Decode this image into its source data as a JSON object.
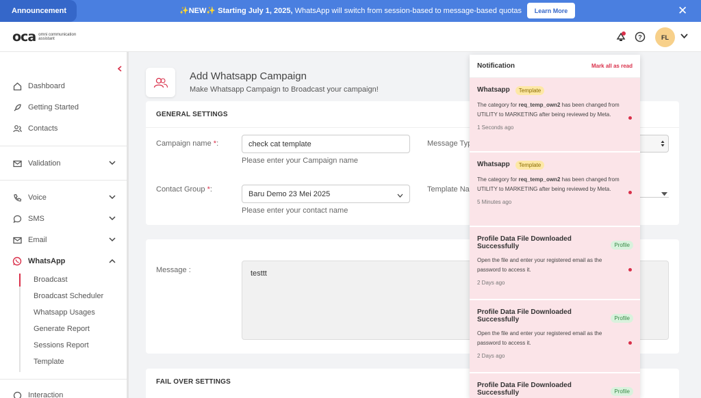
{
  "announcement": {
    "tag": "Announcement",
    "new_label": "✨NEW✨",
    "headline": "Starting July 1, 2025,",
    "message": "WhatsApp will switch from session-based to message-based quotas",
    "learn_more": "Learn More",
    "close": "✕"
  },
  "header": {
    "logo_mark": "oca",
    "logo_sub": "omni communication assistant",
    "avatar": "FL"
  },
  "sidebar": {
    "items": [
      {
        "label": "Dashboard"
      },
      {
        "label": "Getting Started"
      },
      {
        "label": "Contacts"
      },
      {
        "label": "Validation"
      },
      {
        "label": "Voice"
      },
      {
        "label": "SMS"
      },
      {
        "label": "Email"
      },
      {
        "label": "WhatsApp"
      },
      {
        "label": "Interaction"
      }
    ],
    "whatsapp_sub": [
      "Broadcast",
      "Broadcast Scheduler",
      "Whatsapp Usages",
      "Generate Report",
      "Sessions Report",
      "Template"
    ]
  },
  "page": {
    "title": "Add Whatsapp Campaign",
    "subtitle": "Make Whatsapp Campaign to Broadcast your campaign!"
  },
  "general": {
    "title": "GENERAL SETTINGS",
    "campaign_label": "Campaign name",
    "campaign_value": "check cat template",
    "campaign_help": "Please enter your Campaign name",
    "message_type_label": "Message Typ",
    "contact_label": "Contact Group",
    "contact_value": "Baru Demo 23 Mei 2025",
    "contact_help": "Please enter your contact name",
    "template_label": "Template Na",
    "required": "*",
    "colon": ":"
  },
  "message": {
    "label": "Message :",
    "value": "testtt"
  },
  "failover": {
    "title": "FAIL OVER SETTINGS"
  },
  "notifications": {
    "title": "Notification",
    "mark_all": "Mark all as read",
    "items": [
      {
        "title": "Whatsapp",
        "badge": "Template",
        "body_a": "The category for ",
        "body_b": "req_temp_own2",
        "body_c": " has been changed from UTILITY to MARKETING after being reviewed by Meta.",
        "time": "1 Seconds ago"
      },
      {
        "title": "Whatsapp",
        "badge": "Template",
        "body_a": "The category for ",
        "body_b": "req_temp_own2",
        "body_c": " has been changed from UTILITY to MARKETING after being reviewed by Meta.",
        "time": "5 Minutes ago"
      },
      {
        "title": "Profile Data File Downloaded Successfully",
        "badge": "Profile",
        "body": "Open the file and enter your registered email as the password to access it.",
        "time": "2 Days ago"
      },
      {
        "title": "Profile Data File Downloaded Successfully",
        "badge": "Profile",
        "body": "Open the file and enter your registered email as the password to access it.",
        "time": "2 Days ago"
      },
      {
        "title": "Profile Data File Downloaded Successfully",
        "badge": "Profile"
      }
    ]
  },
  "colors": {
    "accent": "#d9304a",
    "announce": "#4a7fe0",
    "notif_bg": "#fbe4e8"
  }
}
